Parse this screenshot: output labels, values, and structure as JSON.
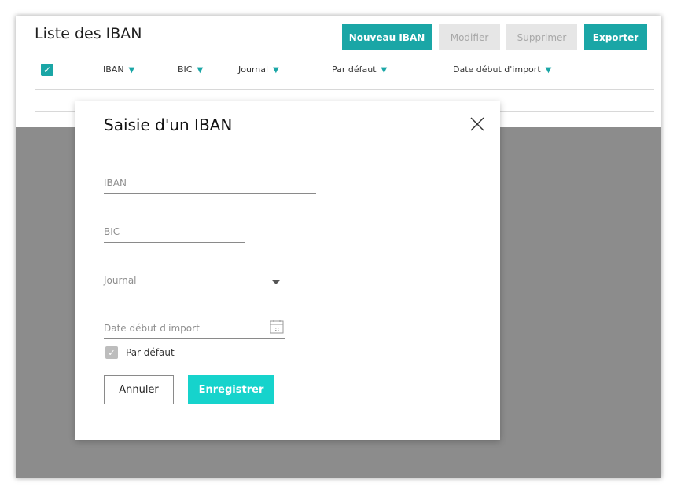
{
  "page": {
    "title": "Liste des IBAN",
    "toolbar": {
      "new_label": "Nouveau IBAN",
      "edit_label": "Modifier",
      "delete_label": "Supprimer",
      "export_label": "Exporter"
    },
    "columns": [
      {
        "label": "IBAN"
      },
      {
        "label": "BIC"
      },
      {
        "label": "Journal"
      },
      {
        "label": "Par défaut"
      },
      {
        "label": "Date début d'import"
      }
    ],
    "sort_arrow": "▼",
    "check_glyph": "✓"
  },
  "modal": {
    "title": "Saisie d'un IBAN",
    "fields": {
      "iban": {
        "placeholder": "IBAN",
        "value": ""
      },
      "bic": {
        "placeholder": "BIC",
        "value": ""
      },
      "journal": {
        "placeholder": "Journal",
        "value": ""
      },
      "date": {
        "placeholder": "Date début d'import",
        "value": ""
      }
    },
    "default_checkbox": {
      "label": "Par défaut",
      "checked": true
    },
    "cancel_label": "Annuler",
    "save_label": "Enregistrer"
  },
  "colors": {
    "accent": "#1aa6a6",
    "save": "#16d3cc",
    "disabled": "#e6e6e6"
  }
}
